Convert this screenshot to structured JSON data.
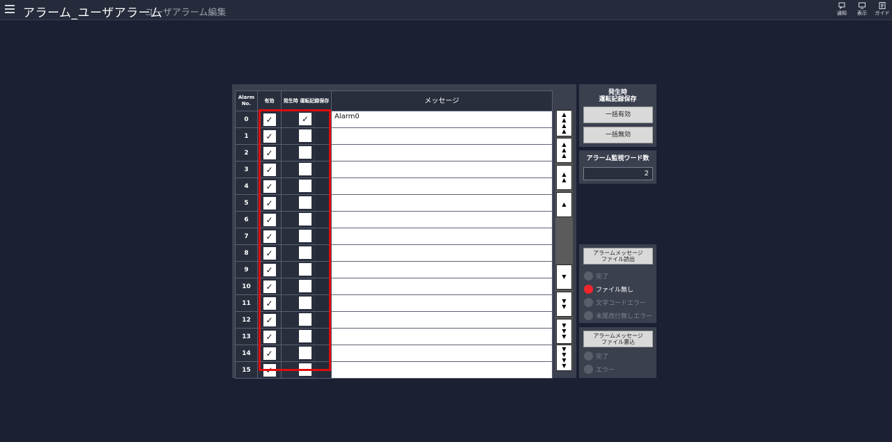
{
  "header": {
    "title": "アラーム_ユーザアラーム",
    "subtitle": "ユーザアラーム編集",
    "icons": [
      {
        "name": "notification-icon",
        "label": "通知"
      },
      {
        "name": "display-icon",
        "label": "表示"
      },
      {
        "name": "guide-icon",
        "label": "ガイド"
      }
    ]
  },
  "table": {
    "headers": {
      "alarm_no": "Alarm No.",
      "enabled": "有効",
      "save": "発生時 運転記録保存",
      "message": "メッセージ"
    },
    "rows": [
      {
        "no": "0",
        "enabled": "✓",
        "save": "✓",
        "message": "Alarm0"
      },
      {
        "no": "1",
        "enabled": "✓",
        "save": "",
        "message": ""
      },
      {
        "no": "2",
        "enabled": "✓",
        "save": "",
        "message": ""
      },
      {
        "no": "3",
        "enabled": "✓",
        "save": "",
        "message": ""
      },
      {
        "no": "4",
        "enabled": "✓",
        "save": "",
        "message": ""
      },
      {
        "no": "5",
        "enabled": "✓",
        "save": "",
        "message": ""
      },
      {
        "no": "6",
        "enabled": "✓",
        "save": "",
        "message": ""
      },
      {
        "no": "7",
        "enabled": "✓",
        "save": "",
        "message": ""
      },
      {
        "no": "8",
        "enabled": "✓",
        "save": "",
        "message": ""
      },
      {
        "no": "9",
        "enabled": "✓",
        "save": "",
        "message": ""
      },
      {
        "no": "10",
        "enabled": "✓",
        "save": "",
        "message": ""
      },
      {
        "no": "11",
        "enabled": "✓",
        "save": "",
        "message": ""
      },
      {
        "no": "12",
        "enabled": "✓",
        "save": "",
        "message": ""
      },
      {
        "no": "13",
        "enabled": "✓",
        "save": "",
        "message": ""
      },
      {
        "no": "14",
        "enabled": "✓",
        "save": "",
        "message": ""
      },
      {
        "no": "15",
        "enabled": "✓",
        "save": "",
        "message": ""
      }
    ]
  },
  "scroll": {
    "up_arrow": "▲",
    "down_arrow": "▼"
  },
  "save_panel": {
    "title_line1": "発生時",
    "title_line2": "運転記録保存",
    "enable_all": "一括有効",
    "disable_all": "一括無効"
  },
  "word_panel": {
    "title": "アラーム監視ワード数",
    "value": "2"
  },
  "read_panel": {
    "button_line1": "アラームメッセージ",
    "button_line2": "ファイル読出",
    "status": [
      "完了",
      "ファイル無し",
      "文字コードエラー",
      "末尾改行無しエラー"
    ],
    "active_index": 1
  },
  "write_panel": {
    "button_line1": "アラームメッセージ",
    "button_line2": "ファイル書込",
    "status": [
      "完了",
      "エラー"
    ]
  },
  "colors": {
    "background": "#1b2033",
    "panel": "#3b404f",
    "highlight": "#e00d0d",
    "led_on": "#f1262b"
  }
}
